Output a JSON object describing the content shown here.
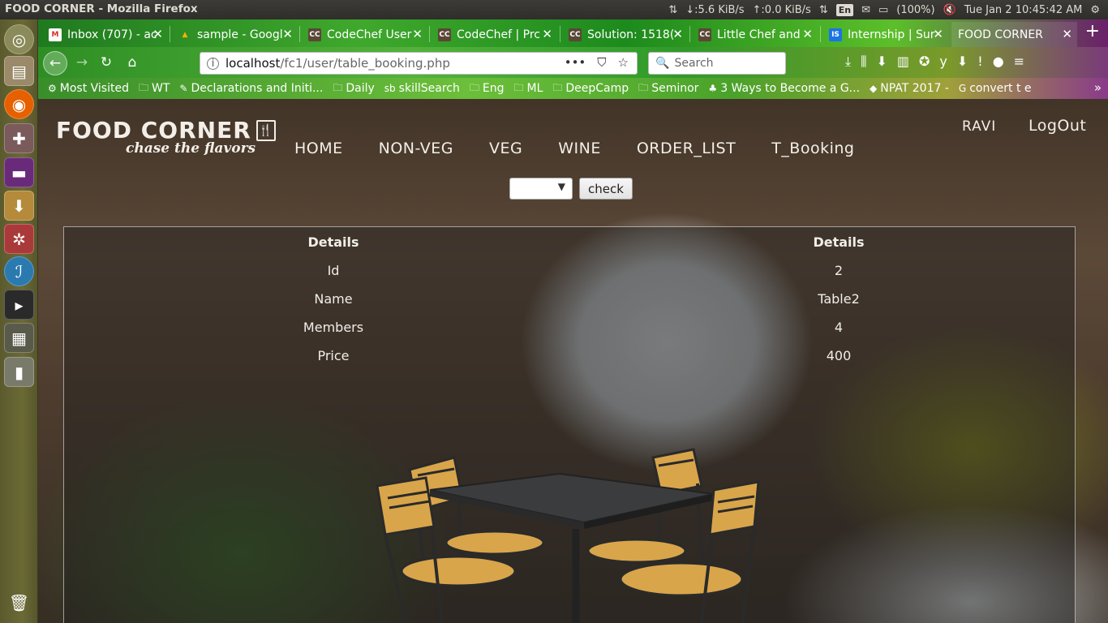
{
  "system": {
    "window_title": "FOOD CORNER - Mozilla Firefox",
    "net_down": "↓:5.6 KiB/s",
    "net_up": "↑:0.0 KiB/s",
    "keyboard": "En",
    "battery": "(100%)",
    "datetime": "Tue Jan 2   10:45:42 AM"
  },
  "tabs": [
    {
      "label": "Inbox (707) - ac",
      "favicon": "M",
      "favicon_color": "#d93025"
    },
    {
      "label": "sample - Googl",
      "favicon": "▲",
      "favicon_color": "#f4b400"
    },
    {
      "label": "CodeChef User",
      "favicon": "CC",
      "favicon_color": "#5b4636"
    },
    {
      "label": "CodeChef | Prc",
      "favicon": "CC",
      "favicon_color": "#5b4636"
    },
    {
      "label": "Solution: 1518(",
      "favicon": "CC",
      "favicon_color": "#5b4636"
    },
    {
      "label": "Little Chef and",
      "favicon": "CC",
      "favicon_color": "#5b4636"
    },
    {
      "label": "Internship | Sur",
      "favicon": "IS",
      "favicon_color": "#1a73e8"
    },
    {
      "label": "FOOD CORNER",
      "favicon": "",
      "favicon_color": ""
    }
  ],
  "address": {
    "host": "localhost",
    "path": "/fc1/user/table_booking.php",
    "search_placeholder": "Search"
  },
  "bookmarks": [
    {
      "label": "Most Visited",
      "icon": "⚙"
    },
    {
      "label": "WT",
      "icon": "🗀"
    },
    {
      "label": "Declarations and Initi...",
      "icon": "✎"
    },
    {
      "label": "Daily",
      "icon": "🗀"
    },
    {
      "label": "skillSearch",
      "icon": "sb"
    },
    {
      "label": "Eng",
      "icon": "🗀"
    },
    {
      "label": "ML",
      "icon": "🗀"
    },
    {
      "label": "DeepCamp",
      "icon": "🗀"
    },
    {
      "label": "Seminor",
      "icon": "🗀"
    },
    {
      "label": "3 Ways to Become a G...",
      "icon": "♣"
    },
    {
      "label": "NPAT 2017 -",
      "icon": "◆"
    },
    {
      "label": "convert t e",
      "icon": "G"
    }
  ],
  "site": {
    "logo_title": "FOOD CORNER",
    "logo_tagline": "chase the flavors",
    "nav": [
      "HOME",
      "NON-VEG",
      "VEG",
      "WINE",
      "ORDER_LIST",
      "T_Booking"
    ],
    "user": "RAVI",
    "logout": "LogOut",
    "select_value": "",
    "check_label": "check"
  },
  "details": {
    "header_left": "Details",
    "header_right": "Details",
    "rows": [
      {
        "label": "Id",
        "value": "2"
      },
      {
        "label": "Name",
        "value": "Table2"
      },
      {
        "label": "Members",
        "value": "4"
      },
      {
        "label": "Price",
        "value": "400"
      }
    ]
  }
}
